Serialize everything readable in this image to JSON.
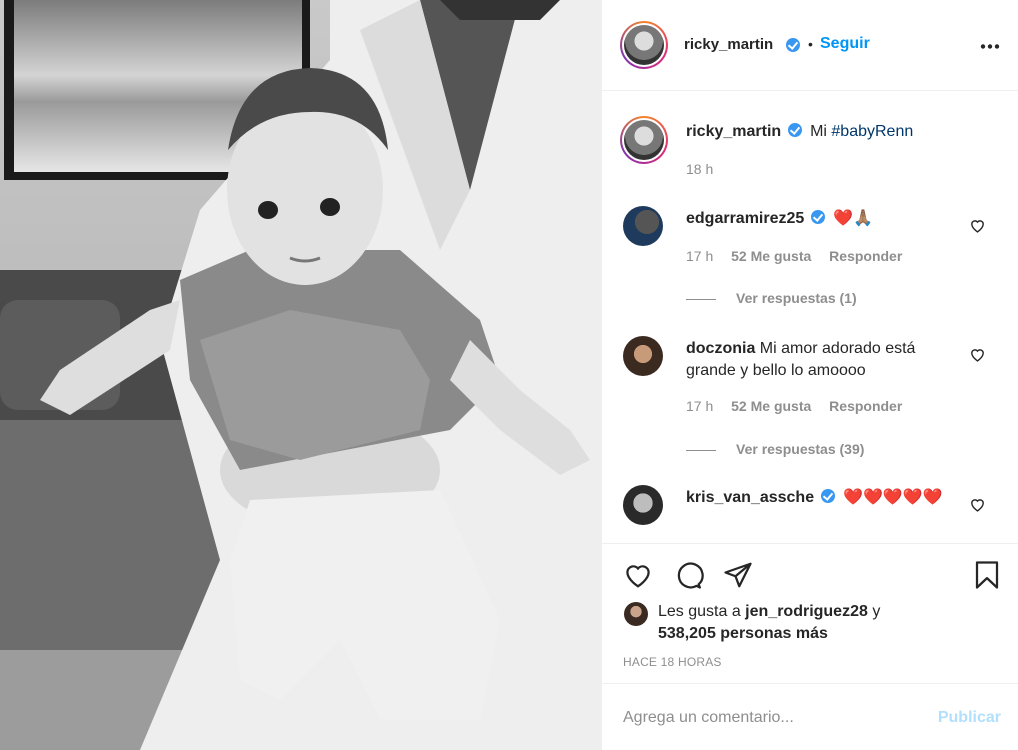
{
  "post": {
    "username": "ricky_martin",
    "follow_label": "Seguir",
    "dot": "•",
    "more_icon": "more-options-icon"
  },
  "caption": {
    "username": "ricky_martin",
    "text": "Mi ",
    "hashtag": "#babyRenn",
    "time": "18 h"
  },
  "comments": [
    {
      "username": "edgarramirez25",
      "text": "❤️🙏🏽",
      "time": "17 h",
      "likes": "52 Me gusta",
      "reply": "Responder",
      "view_replies": "Ver respuestas (1)"
    },
    {
      "username": "doczonia",
      "text": "Mi amor adorado está grande y bello lo amoooo",
      "time": "17 h",
      "likes": "52 Me gusta",
      "reply": "Responder",
      "view_replies": "Ver respuestas (39)"
    },
    {
      "username": "kris_van_assche",
      "text": "❤️❤️❤️❤️❤️"
    }
  ],
  "likes_line": {
    "prefix": "Les gusta a ",
    "user": "jen_rodriguez28",
    "mid": " y",
    "count": "538,205 personas más"
  },
  "timestamp": "HACE 18 HORAS",
  "add_comment": {
    "placeholder": "Agrega un comentario...",
    "publish": "Publicar"
  },
  "colors": {
    "accent": "#0095f6",
    "verified": "#3897f0",
    "heart": "#e0245e",
    "muted": "#8e8e8e"
  }
}
